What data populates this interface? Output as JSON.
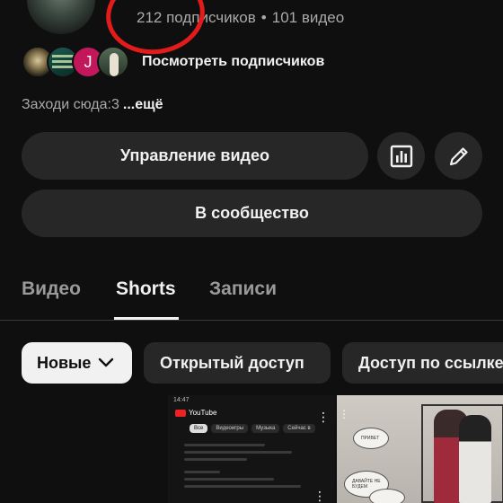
{
  "channel": {
    "subscribers_text": "212 подписчиков",
    "separator": "•",
    "videos_text": "101 видео",
    "subscriber_initial": "J",
    "view_subscribers_label": "Посмотреть подписчиков",
    "description": "Заходи сюда:3",
    "more_label": "...ещё"
  },
  "actions": {
    "manage_videos_label": "Управление видео",
    "stats_icon": "analytics-icon",
    "edit_icon": "pencil-icon",
    "community_label": "В сообщество"
  },
  "tabs": [
    {
      "label": "Видео",
      "active": false
    },
    {
      "label": "Shorts",
      "active": true
    },
    {
      "label": "Записи",
      "active": false
    }
  ],
  "filters": {
    "sort_label": "Новые",
    "chips": [
      "Открытый доступ",
      "Доступ по ссылке"
    ]
  },
  "thumbnails": {
    "first": {
      "status_time": "14:47",
      "logo_text": "YouTube",
      "pills": [
        "Все",
        "Видеоигры",
        "Музыка",
        "Сейчас в"
      ]
    },
    "second": {
      "bubble_texts": [
        "ПРИВЕТ",
        "ДАВАЙТЕ НЕ БУДЕМ"
      ]
    }
  },
  "colors": {
    "background": "#0f0f0f",
    "button_bg": "#272727",
    "annotation_circle": "#e31b1b",
    "secondary_text": "#aaaaaa"
  }
}
